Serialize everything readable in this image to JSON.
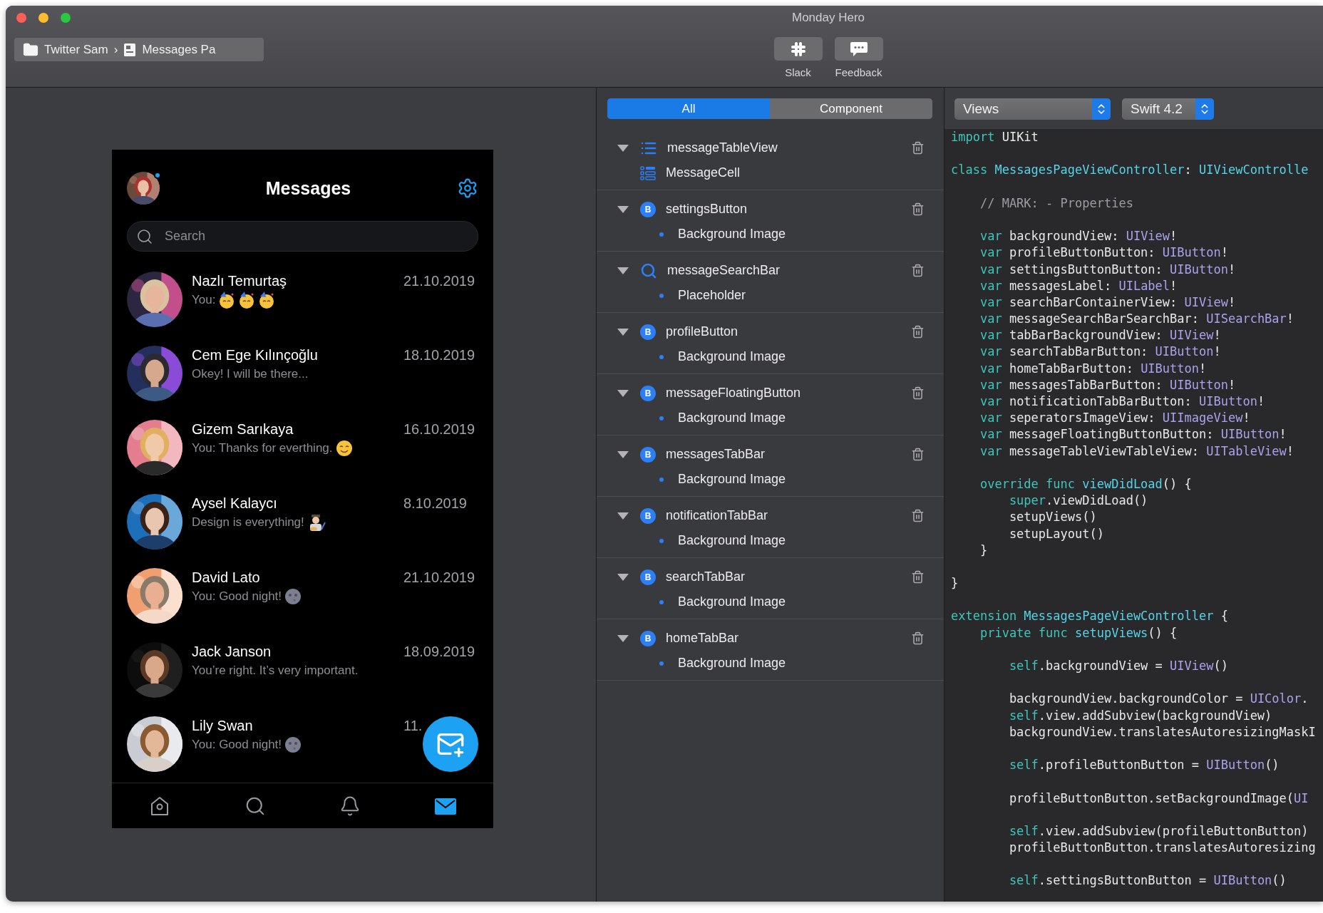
{
  "window": {
    "title": "Monday Hero"
  },
  "toolbar": {
    "breadcrumb": [
      {
        "kind": "folder",
        "label": "Twitter Sam"
      },
      {
        "kind": "page",
        "label": "Messages Pa"
      }
    ],
    "separator": "›",
    "buttons": [
      {
        "kind": "slack",
        "label": "Slack"
      },
      {
        "kind": "feedback",
        "label": "Feedback"
      }
    ]
  },
  "phone": {
    "title": "Messages",
    "profile": {
      "online": true
    },
    "search": {
      "placeholder": "Search"
    },
    "conversations": [
      {
        "name": "Nazlı Temurtaş",
        "message": "You:",
        "emojis": [
          {
            "kind": "party"
          },
          {
            "kind": "party"
          },
          {
            "kind": "party"
          }
        ],
        "date": "21.10.2019"
      },
      {
        "name": "Cem Ege Kılınçoğlu",
        "message": "Okey! I will be there...",
        "date": "18.10.2019"
      },
      {
        "name": "Gizem Sarıkaya",
        "message": "You: Thanks for everthing.",
        "emojis": [
          {
            "kind": "smile"
          }
        ],
        "date": "16.10.2019"
      },
      {
        "name": "Aysel Kalaycı",
        "message": "Design is everything!",
        "emojis": [
          {
            "kind": "artist"
          }
        ],
        "date": "8.10.2019"
      },
      {
        "name": "David Lato",
        "message": "You: Good night!",
        "emojis": [
          {
            "kind": "moon"
          }
        ],
        "date": "21.10.2019"
      },
      {
        "name": "Jack Janson",
        "message": "You’re right. It’s very important.",
        "date": "18.09.2019"
      },
      {
        "name": "Lily Swan",
        "message": "You: Good night!",
        "emojis": [
          {
            "kind": "moon"
          }
        ],
        "date": "11."
      }
    ],
    "tabs": [
      {
        "kind": "home",
        "selected": false
      },
      {
        "kind": "search",
        "selected": false
      },
      {
        "kind": "bell",
        "selected": false
      },
      {
        "kind": "mail",
        "selected": true
      }
    ]
  },
  "layers": {
    "segments": [
      {
        "label": "All",
        "selected": true
      },
      {
        "label": "Component",
        "selected": false
      }
    ],
    "items": [
      {
        "kind": "list",
        "name": "messageTableView",
        "expanded": true,
        "children": [
          {
            "kind": "icon",
            "label": "MessageCell"
          }
        ]
      },
      {
        "kind": "badge",
        "badge": "B",
        "name": "settingsButton",
        "expanded": true,
        "children": [
          {
            "kind": "bullet",
            "label": "Background Image"
          }
        ]
      },
      {
        "kind": "search",
        "name": "messageSearchBar",
        "expanded": true,
        "children": [
          {
            "kind": "bullet",
            "label": "Placeholder"
          }
        ]
      },
      {
        "kind": "badge",
        "badge": "B",
        "name": "profileButton",
        "expanded": true,
        "children": [
          {
            "kind": "bullet",
            "label": "Background Image"
          }
        ]
      },
      {
        "kind": "badge",
        "badge": "B",
        "name": "messageFloatingButton",
        "expanded": true,
        "children": [
          {
            "kind": "bullet",
            "label": "Background Image"
          }
        ]
      },
      {
        "kind": "badge",
        "badge": "B",
        "name": "messagesTabBar",
        "expanded": true,
        "children": [
          {
            "kind": "bullet",
            "label": "Background Image"
          }
        ]
      },
      {
        "kind": "badge",
        "badge": "B",
        "name": "notificationTabBar",
        "expanded": true,
        "children": [
          {
            "kind": "bullet",
            "label": "Background Image"
          }
        ]
      },
      {
        "kind": "badge",
        "badge": "B",
        "name": "searchTabBar",
        "expanded": true,
        "children": [
          {
            "kind": "bullet",
            "label": "Background Image"
          }
        ]
      },
      {
        "kind": "badge",
        "badge": "B",
        "name": "homeTabBar",
        "expanded": true,
        "children": [
          {
            "kind": "bullet",
            "label": "Background Image"
          }
        ]
      }
    ]
  },
  "code": {
    "selectors": [
      {
        "value": "Views"
      },
      {
        "value": "Swift 4.2"
      }
    ],
    "blocks": [
      [
        [
          {
            "kind": "k",
            "text": "import"
          },
          {
            "kind": "p",
            "text": " UIKit"
          }
        ]
      ],
      [
        [
          {
            "kind": "k",
            "text": "class "
          },
          {
            "kind": "d",
            "text": "MessagesPageViewController"
          },
          {
            "kind": "p",
            "text": ": "
          },
          {
            "kind": "d",
            "text": "UIViewControlle"
          }
        ]
      ],
      [
        [
          {
            "kind": "c",
            "text": "    // MARK: - Properties"
          }
        ]
      ],
      [
        [
          {
            "kind": "k",
            "text": "    var"
          },
          {
            "kind": "p",
            "text": " backgroundView: "
          },
          {
            "kind": "t",
            "text": "UIView"
          },
          {
            "kind": "p",
            "text": "!"
          }
        ],
        [
          {
            "kind": "k",
            "text": "    var"
          },
          {
            "kind": "p",
            "text": " profileButtonButton: "
          },
          {
            "kind": "t",
            "text": "UIButton"
          },
          {
            "kind": "p",
            "text": "!"
          }
        ],
        [
          {
            "kind": "k",
            "text": "    var"
          },
          {
            "kind": "p",
            "text": " settingsButtonButton: "
          },
          {
            "kind": "t",
            "text": "UIButton"
          },
          {
            "kind": "p",
            "text": "!"
          }
        ],
        [
          {
            "kind": "k",
            "text": "    var"
          },
          {
            "kind": "p",
            "text": " messagesLabel: "
          },
          {
            "kind": "t",
            "text": "UILabel"
          },
          {
            "kind": "p",
            "text": "!"
          }
        ],
        [
          {
            "kind": "k",
            "text": "    var"
          },
          {
            "kind": "p",
            "text": " searchBarContainerView: "
          },
          {
            "kind": "t",
            "text": "UIView"
          },
          {
            "kind": "p",
            "text": "!"
          }
        ],
        [
          {
            "kind": "k",
            "text": "    var"
          },
          {
            "kind": "p",
            "text": " messageSearchBarSearchBar: "
          },
          {
            "kind": "t",
            "text": "UISearchBar"
          },
          {
            "kind": "p",
            "text": "!"
          }
        ],
        [
          {
            "kind": "k",
            "text": "    var"
          },
          {
            "kind": "p",
            "text": " tabBarBackgroundView: "
          },
          {
            "kind": "t",
            "text": "UIView"
          },
          {
            "kind": "p",
            "text": "!"
          }
        ],
        [
          {
            "kind": "k",
            "text": "    var"
          },
          {
            "kind": "p",
            "text": " searchTabBarButton: "
          },
          {
            "kind": "t",
            "text": "UIButton"
          },
          {
            "kind": "p",
            "text": "!"
          }
        ],
        [
          {
            "kind": "k",
            "text": "    var"
          },
          {
            "kind": "p",
            "text": " homeTabBarButton: "
          },
          {
            "kind": "t",
            "text": "UIButton"
          },
          {
            "kind": "p",
            "text": "!"
          }
        ],
        [
          {
            "kind": "k",
            "text": "    var"
          },
          {
            "kind": "p",
            "text": " messagesTabBarButton: "
          },
          {
            "kind": "t",
            "text": "UIButton"
          },
          {
            "kind": "p",
            "text": "!"
          }
        ],
        [
          {
            "kind": "k",
            "text": "    var"
          },
          {
            "kind": "p",
            "text": " notificationTabBarButton: "
          },
          {
            "kind": "t",
            "text": "UIButton"
          },
          {
            "kind": "p",
            "text": "!"
          }
        ],
        [
          {
            "kind": "k",
            "text": "    var"
          },
          {
            "kind": "p",
            "text": " seperatorsImageView: "
          },
          {
            "kind": "t",
            "text": "UIImageView"
          },
          {
            "kind": "p",
            "text": "!"
          }
        ],
        [
          {
            "kind": "k",
            "text": "    var"
          },
          {
            "kind": "p",
            "text": " messageFloatingButtonButton: "
          },
          {
            "kind": "t",
            "text": "UIButton"
          },
          {
            "kind": "p",
            "text": "!"
          }
        ],
        [
          {
            "kind": "k",
            "text": "    var"
          },
          {
            "kind": "p",
            "text": " messageTableViewTableView: "
          },
          {
            "kind": "t",
            "text": "UITableView"
          },
          {
            "kind": "p",
            "text": "!"
          }
        ]
      ],
      [
        [
          {
            "kind": "k",
            "text": "    override func "
          },
          {
            "kind": "d",
            "text": "viewDidLoad"
          },
          {
            "kind": "p",
            "text": "() {"
          }
        ],
        [
          {
            "kind": "k",
            "text": "        super"
          },
          {
            "kind": "p",
            "text": ".viewDidLoad()"
          }
        ],
        [
          {
            "kind": "p",
            "text": "        setupViews()"
          }
        ],
        [
          {
            "kind": "p",
            "text": "        setupLayout()"
          }
        ],
        [
          {
            "kind": "p",
            "text": "    }"
          }
        ]
      ],
      [
        [
          {
            "kind": "p",
            "text": "}"
          }
        ]
      ],
      [
        [
          {
            "kind": "k",
            "text": "extension "
          },
          {
            "kind": "d",
            "text": "MessagesPageViewController"
          },
          {
            "kind": "p",
            "text": " {"
          }
        ],
        [
          {
            "kind": "k",
            "text": "    private func "
          },
          {
            "kind": "d",
            "text": "setupViews"
          },
          {
            "kind": "p",
            "text": "() {"
          }
        ]
      ],
      [
        [
          {
            "kind": "k",
            "text": "        self"
          },
          {
            "kind": "p",
            "text": ".backgroundView = "
          },
          {
            "kind": "t",
            "text": "UIView"
          },
          {
            "kind": "p",
            "text": "()"
          }
        ]
      ],
      [
        [
          {
            "kind": "p",
            "text": "        backgroundView.backgroundColor = "
          },
          {
            "kind": "t",
            "text": "UIColor"
          },
          {
            "kind": "p",
            "text": "."
          }
        ],
        [
          {
            "kind": "k",
            "text": "        self"
          },
          {
            "kind": "p",
            "text": ".view.addSubview(backgroundView)"
          }
        ],
        [
          {
            "kind": "p",
            "text": "        backgroundView.translatesAutoresizingMaskI"
          }
        ]
      ],
      [
        [
          {
            "kind": "k",
            "text": "        self"
          },
          {
            "kind": "p",
            "text": ".profileButtonButton = "
          },
          {
            "kind": "t",
            "text": "UIButton"
          },
          {
            "kind": "p",
            "text": "()"
          }
        ]
      ],
      [
        [
          {
            "kind": "p",
            "text": "        profileButtonButton.setBackgroundImage("
          },
          {
            "kind": "t",
            "text": "UI"
          }
        ]
      ],
      [
        [
          {
            "kind": "k",
            "text": "        self"
          },
          {
            "kind": "p",
            "text": ".view.addSubview(profileButtonButton)"
          }
        ],
        [
          {
            "kind": "p",
            "text": "        profileButtonButton.translatesAutoresizing"
          }
        ]
      ],
      [
        [
          {
            "kind": "k",
            "text": "        self"
          },
          {
            "kind": "p",
            "text": ".settingsButtonButton = "
          },
          {
            "kind": "t",
            "text": "UIButton"
          },
          {
            "kind": "p",
            "text": "()"
          }
        ]
      ]
    ]
  }
}
